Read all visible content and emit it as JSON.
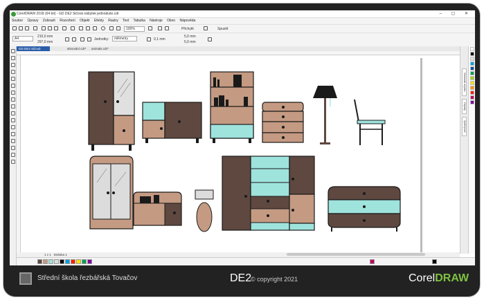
{
  "window": {
    "title": "CorelDRAW 2018 (64 bit) - GD DE2 Sičová nábytek jednoduše.cdr",
    "controls": "– ▢ ✕"
  },
  "menu": [
    "Soubor",
    "Úpravy",
    "Zobrazit",
    "Rozvržení",
    "Objekt",
    "Efekty",
    "Rastry",
    "Text",
    "Tabulka",
    "Nástroje",
    "Okno",
    "Nápověda"
  ],
  "toolbar": {
    "zoom": "100%",
    "snap_label": "Přichytit",
    "launch_label": "Spustit",
    "font_preset": "A4",
    "width": "210,0 mm",
    "height": "297,0 mm",
    "units_label": "Jednotky:",
    "units_value": "milimetry",
    "nudge": "0,1 mm",
    "dup_x": "5,0 mm",
    "dup_y": "5,0 mm"
  },
  "tabs": [
    {
      "label": "GD DE2 Sičová nábytek...",
      "active": true
    },
    {
      "label": "stinování.cdr*",
      "active": false
    },
    {
      "label": "animals.cdr*",
      "active": false
    }
  ],
  "statusbar": {
    "page_nav": "1 z 1",
    "page_label": "Stránka 1"
  },
  "dock": {
    "tab1": "Vlastnosti objektu",
    "tab2": "Objekty",
    "tab3": "Zpět/Vpřed"
  },
  "colors": {
    "dark_brown": "#5e4840",
    "light_brown": "#c49a82",
    "mint": "#9fe3dd",
    "light_gray": "#dcdcdc",
    "black": "#1a1a1a",
    "frame": "#222222",
    "accent_tab": "#2a5caa",
    "corel_green": "#7ec242"
  },
  "palette_colors": [
    "#ffffff",
    "#000000",
    "#e0e0e0",
    "#00a0e0",
    "#0050a0",
    "#00a050",
    "#a0d000",
    "#ffe000",
    "#ff9000",
    "#ff2000",
    "#c00060",
    "#8000a0",
    "#6b4a2a",
    "#c49a82",
    "#9fe3dd",
    "#5e4840"
  ],
  "footer": {
    "school": "Střední škola řezbářská Tovačov",
    "course": "DE2",
    "copyright": "© copyright 2021",
    "brand_corel": "Corel",
    "brand_draw": "DRAW"
  }
}
